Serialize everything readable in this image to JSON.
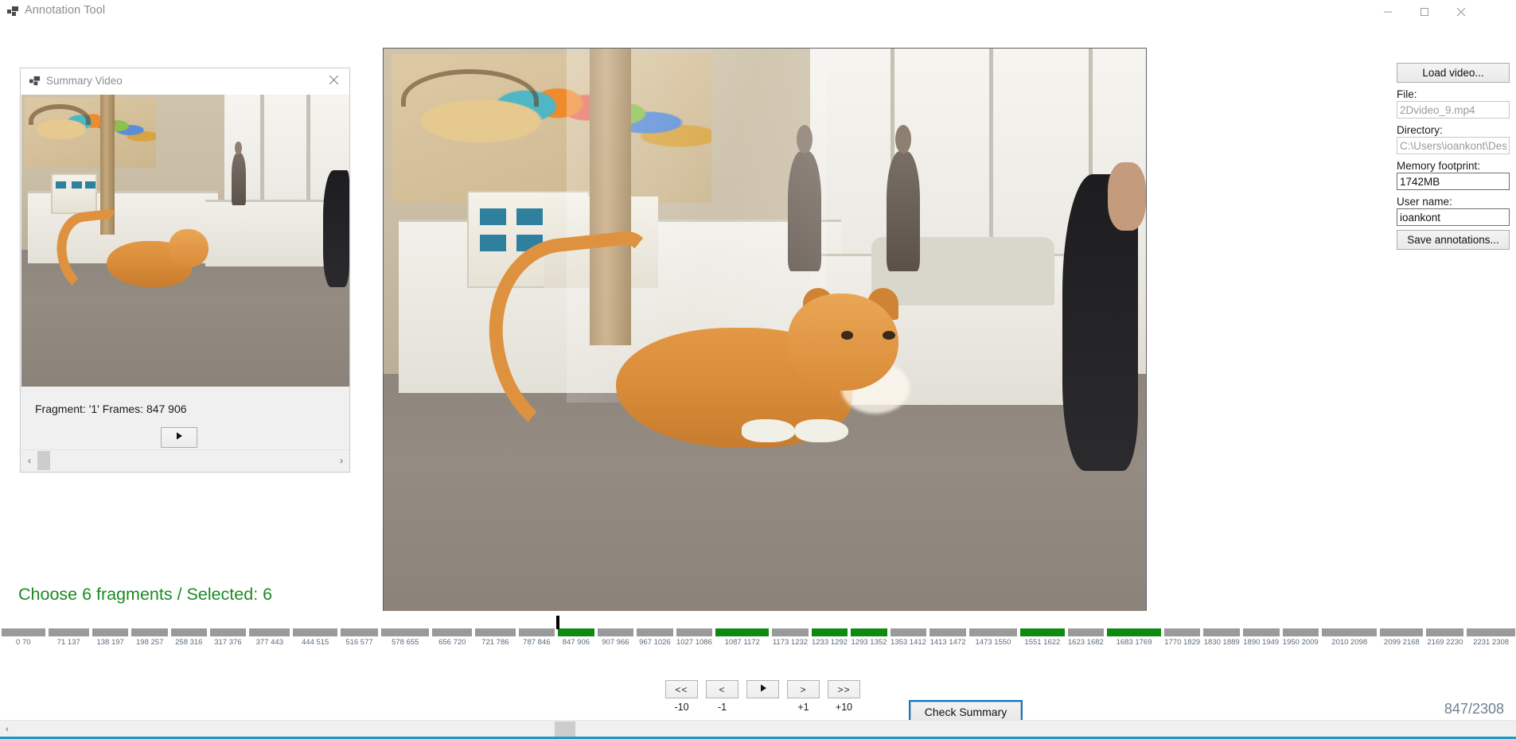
{
  "window": {
    "title": "Annotation Tool",
    "app_icon": "app-squares-icon",
    "minimize_icon": "minimize-icon",
    "maximize_icon": "maximize-icon",
    "close_icon": "close-icon"
  },
  "summary_dialog": {
    "title": "Summary Video",
    "icon": "app-squares-icon",
    "close_icon": "close-icon",
    "fragment_text": "Fragment: '1' Frames: 847 906",
    "play_icon": "play-icon",
    "scroll_left_icon": "chevron-left-icon",
    "scroll_right_icon": "chevron-right-icon"
  },
  "status": {
    "text": "Choose 6 fragments / Selected: 6",
    "color": "#1a8a22"
  },
  "right_panel": {
    "load_video_label": "Load video...",
    "file_label": "File:",
    "file_value": "2Dvideo_9.mp4",
    "directory_label": "Directory:",
    "directory_value": "C:\\Users\\ioankont\\Deskto",
    "memory_label": "Memory footprint:",
    "memory_value": "1742MB",
    "username_label": "User name:",
    "username_value": "ioankont",
    "save_annotations_label": "Save annotations..."
  },
  "timeline": {
    "playhead_frame": 847,
    "total_frames": 2308,
    "selected_color": "#0f8a10",
    "unselected_color": "#9a9a9a",
    "segments": [
      {
        "label": "0 70",
        "start": 0,
        "end": 70,
        "selected": false
      },
      {
        "label": "71 137",
        "start": 71,
        "end": 137,
        "selected": false
      },
      {
        "label": "138 197",
        "start": 138,
        "end": 197,
        "selected": false
      },
      {
        "label": "198 257",
        "start": 198,
        "end": 257,
        "selected": false
      },
      {
        "label": "258 316",
        "start": 258,
        "end": 316,
        "selected": false
      },
      {
        "label": "317 376",
        "start": 317,
        "end": 376,
        "selected": false
      },
      {
        "label": "377 443",
        "start": 377,
        "end": 443,
        "selected": false
      },
      {
        "label": "444 515",
        "start": 444,
        "end": 515,
        "selected": false
      },
      {
        "label": "516 577",
        "start": 516,
        "end": 577,
        "selected": false
      },
      {
        "label": "578 655",
        "start": 578,
        "end": 655,
        "selected": false
      },
      {
        "label": "656 720",
        "start": 656,
        "end": 720,
        "selected": false
      },
      {
        "label": "721 786",
        "start": 721,
        "end": 786,
        "selected": false
      },
      {
        "label": "787 846",
        "start": 787,
        "end": 846,
        "selected": false
      },
      {
        "label": "847 906",
        "start": 847,
        "end": 906,
        "selected": true
      },
      {
        "label": "907 966",
        "start": 907,
        "end": 966,
        "selected": false
      },
      {
        "label": "967 1026",
        "start": 967,
        "end": 1026,
        "selected": false
      },
      {
        "label": "1027 1086",
        "start": 1027,
        "end": 1086,
        "selected": false
      },
      {
        "label": "1087 1172",
        "start": 1087,
        "end": 1172,
        "selected": true
      },
      {
        "label": "1173 1232",
        "start": 1173,
        "end": 1232,
        "selected": false
      },
      {
        "label": "1233 1292",
        "start": 1233,
        "end": 1292,
        "selected": true
      },
      {
        "label": "1293 1352",
        "start": 1293,
        "end": 1352,
        "selected": true
      },
      {
        "label": "1353 1412",
        "start": 1353,
        "end": 1412,
        "selected": false
      },
      {
        "label": "1413 1472",
        "start": 1413,
        "end": 1472,
        "selected": false
      },
      {
        "label": "1473 1550",
        "start": 1473,
        "end": 1550,
        "selected": false
      },
      {
        "label": "1551 1622",
        "start": 1551,
        "end": 1622,
        "selected": true
      },
      {
        "label": "1623 1682",
        "start": 1623,
        "end": 1682,
        "selected": false
      },
      {
        "label": "1683 1769",
        "start": 1683,
        "end": 1769,
        "selected": true
      },
      {
        "label": "1770 1829",
        "start": 1770,
        "end": 1829,
        "selected": false
      },
      {
        "label": "1830 1889",
        "start": 1830,
        "end": 1889,
        "selected": false
      },
      {
        "label": "1890 1949",
        "start": 1890,
        "end": 1949,
        "selected": false
      },
      {
        "label": "1950 2009",
        "start": 1950,
        "end": 2009,
        "selected": false
      },
      {
        "label": "2010 2098",
        "start": 2010,
        "end": 2098,
        "selected": false
      },
      {
        "label": "2099 2168",
        "start": 2099,
        "end": 2168,
        "selected": false
      },
      {
        "label": "2169 2230",
        "start": 2169,
        "end": 2230,
        "selected": false
      },
      {
        "label": "2231 2308",
        "start": 2231,
        "end": 2308,
        "selected": false
      }
    ]
  },
  "transport": {
    "buttons": [
      {
        "glyph": "<<",
        "label": "-10",
        "icon": "skip-back-icon"
      },
      {
        "glyph": "<",
        "label": "-1",
        "icon": "step-back-icon"
      },
      {
        "glyph": "",
        "label": "",
        "icon": "play-icon"
      },
      {
        "glyph": ">",
        "label": "+1",
        "icon": "step-forward-icon"
      },
      {
        "glyph": ">>",
        "label": "+10",
        "icon": "skip-forward-icon"
      }
    ],
    "check_summary_label": "Check Summary",
    "frame_counter": "847/2308"
  },
  "bottom_scrollbar": {
    "left_arrow_icon": "chevron-left-icon"
  }
}
